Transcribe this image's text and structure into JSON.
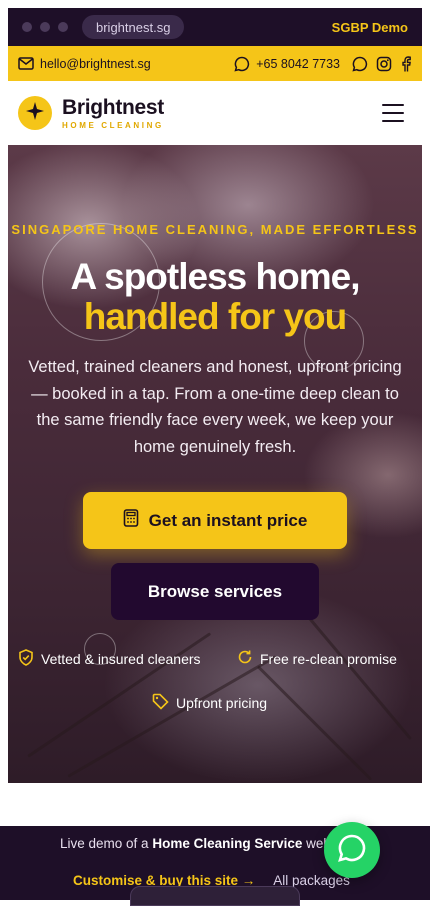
{
  "browser": {
    "url": "brightnest.sg",
    "demo_label": "SGBP Demo"
  },
  "contact": {
    "email": "hello@brightnest.sg",
    "phone": "+65 8042 7733"
  },
  "brand": {
    "name": "Brightnest",
    "tagline": "HOME CLEANING"
  },
  "hero": {
    "eyebrow": "SINGAPORE HOME CLEANING, MADE EFFORTLESS",
    "headline_line1": "A spotless home,",
    "headline_line2": "handled for you",
    "subtext": "Vetted, trained cleaners and honest, upfront pricing — booked in a tap. From a one-time deep clean to the same friendly face every week, we keep your home genuinely fresh.",
    "primary_cta": "Get an instant price",
    "secondary_cta": "Browse services",
    "trust": [
      "Vetted & insured cleaners",
      "Free re-clean promise",
      "Upfront pricing"
    ]
  },
  "footer": {
    "line1_prefix": "Live demo of a",
    "line1_bold": "Home Cleaning Service",
    "line1_suffix": "websi",
    "buy_link": "Customise & buy this site →",
    "packages_link": "All packages"
  },
  "colors": {
    "accent": "#f5c518",
    "dark": "#1e0f28",
    "button_dark": "#22092f",
    "whatsapp": "#25d366"
  },
  "icons": [
    "mail-icon",
    "chat-bubble-icon",
    "whatsapp-icon",
    "instagram-icon",
    "facebook-icon",
    "sparkle-icon",
    "menu-icon",
    "calculator-icon",
    "shield-check-icon",
    "refresh-icon",
    "tag-icon",
    "whatsapp-chat-icon"
  ]
}
